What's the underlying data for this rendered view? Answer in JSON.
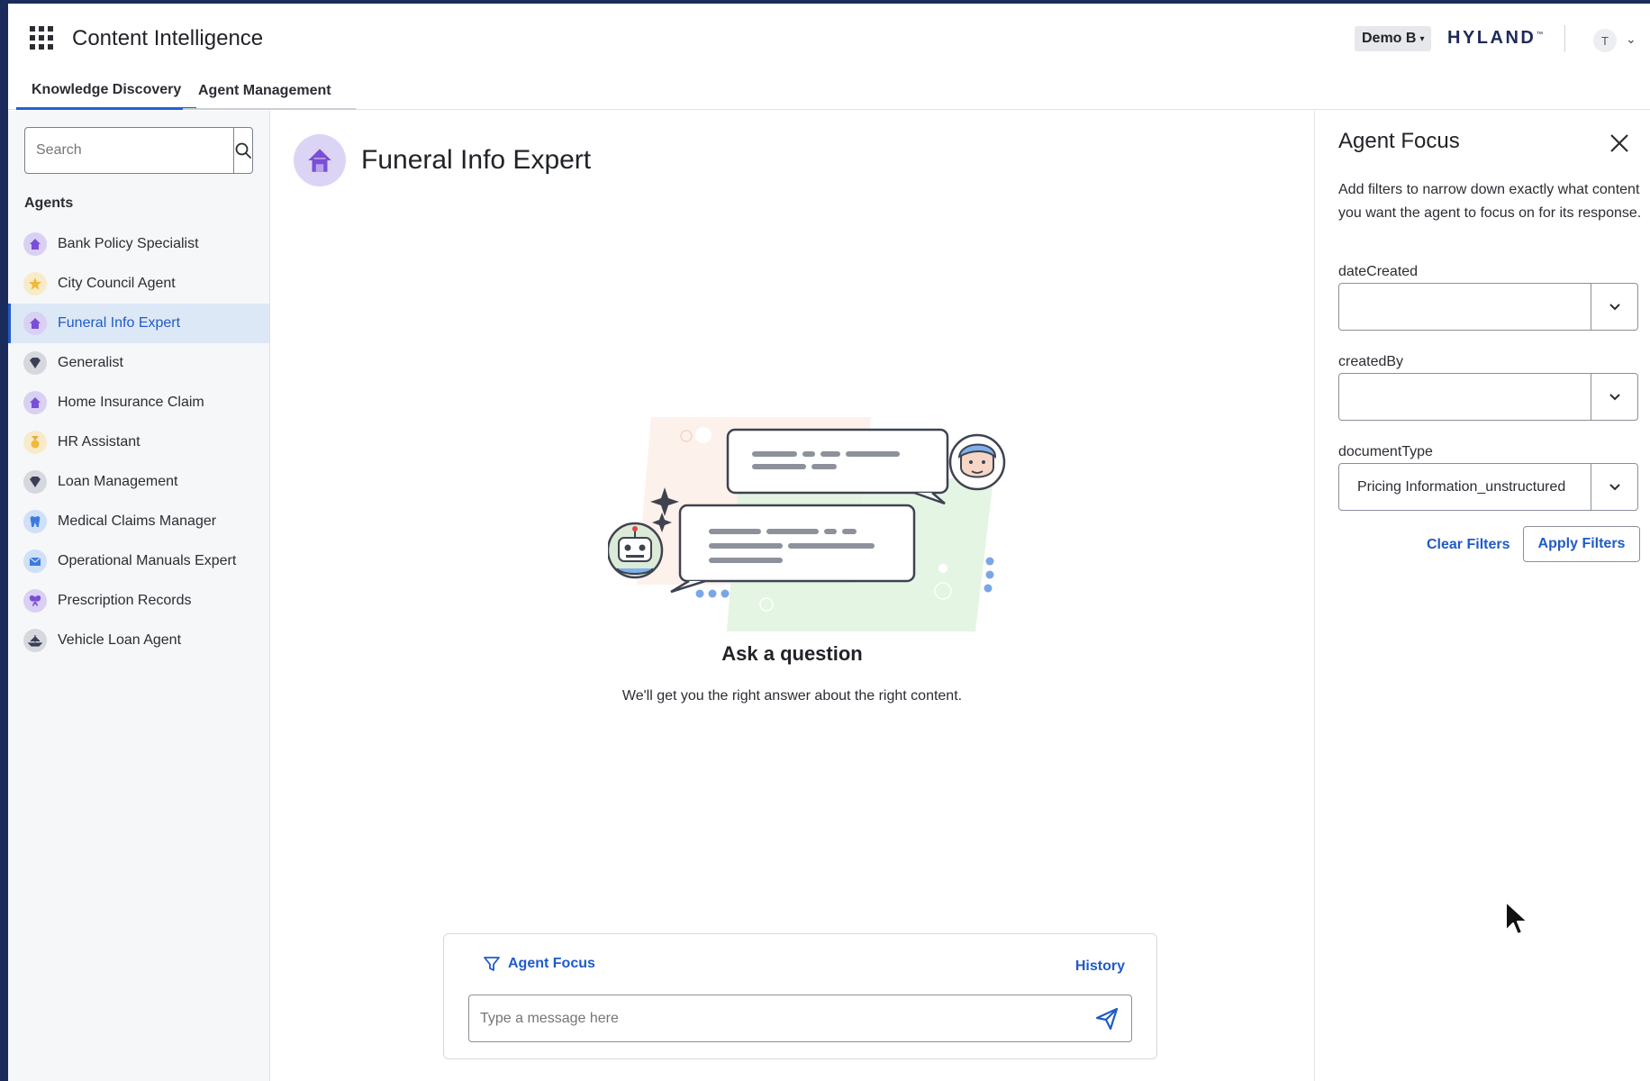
{
  "header": {
    "app_title": "Content Intelligence",
    "tenant": "Demo B",
    "brand": "HYLAND",
    "brand_tm": "™",
    "avatar_initial": "T"
  },
  "tabs": [
    {
      "label": "Knowledge Discovery",
      "active": true
    },
    {
      "label": "Agent Management",
      "active": false
    }
  ],
  "sidebar": {
    "search_placeholder": "Search",
    "section_label": "Agents",
    "agents": [
      {
        "label": "Bank Policy Specialist",
        "icon": "house-icon",
        "selected": false
      },
      {
        "label": "City Council Agent",
        "icon": "star-icon",
        "selected": false
      },
      {
        "label": "Funeral Info Expert",
        "icon": "house-icon",
        "selected": true
      },
      {
        "label": "Generalist",
        "icon": "diamond-icon",
        "selected": false
      },
      {
        "label": "Home Insurance Claim",
        "icon": "house-icon",
        "selected": false
      },
      {
        "label": "HR Assistant",
        "icon": "medal-icon",
        "selected": false
      },
      {
        "label": "Loan Management",
        "icon": "diamond-icon",
        "selected": false
      },
      {
        "label": "Medical Claims Manager",
        "icon": "tooth-icon",
        "selected": false
      },
      {
        "label": "Operational Manuals Expert",
        "icon": "envelope-icon",
        "selected": false
      },
      {
        "label": "Prescription Records",
        "icon": "butterfly-icon",
        "selected": false
      },
      {
        "label": "Vehicle Loan Agent",
        "icon": "ship-icon",
        "selected": false
      }
    ]
  },
  "main": {
    "agent_title": "Funeral Info Expert",
    "empty_title": "Ask a question",
    "empty_subtitle": "We'll get you the right answer about the right content.",
    "composer": {
      "focus_label": "Agent Focus",
      "history_label": "History",
      "message_placeholder": "Type a message here"
    }
  },
  "panel": {
    "title": "Agent Focus",
    "description": "Add filters to narrow down exactly what content you want the agent to focus on for its response.",
    "filters": [
      {
        "label": "dateCreated",
        "value": ""
      },
      {
        "label": "createdBy",
        "value": ""
      },
      {
        "label": "documentType",
        "value": "Pricing Information_unstructured"
      }
    ],
    "clear_label": "Clear Filters",
    "apply_label": "Apply Filters"
  },
  "colors": {
    "accent": "#1f5bc8",
    "selected_bg": "#dde8f7",
    "frame": "#1a2b5c"
  }
}
